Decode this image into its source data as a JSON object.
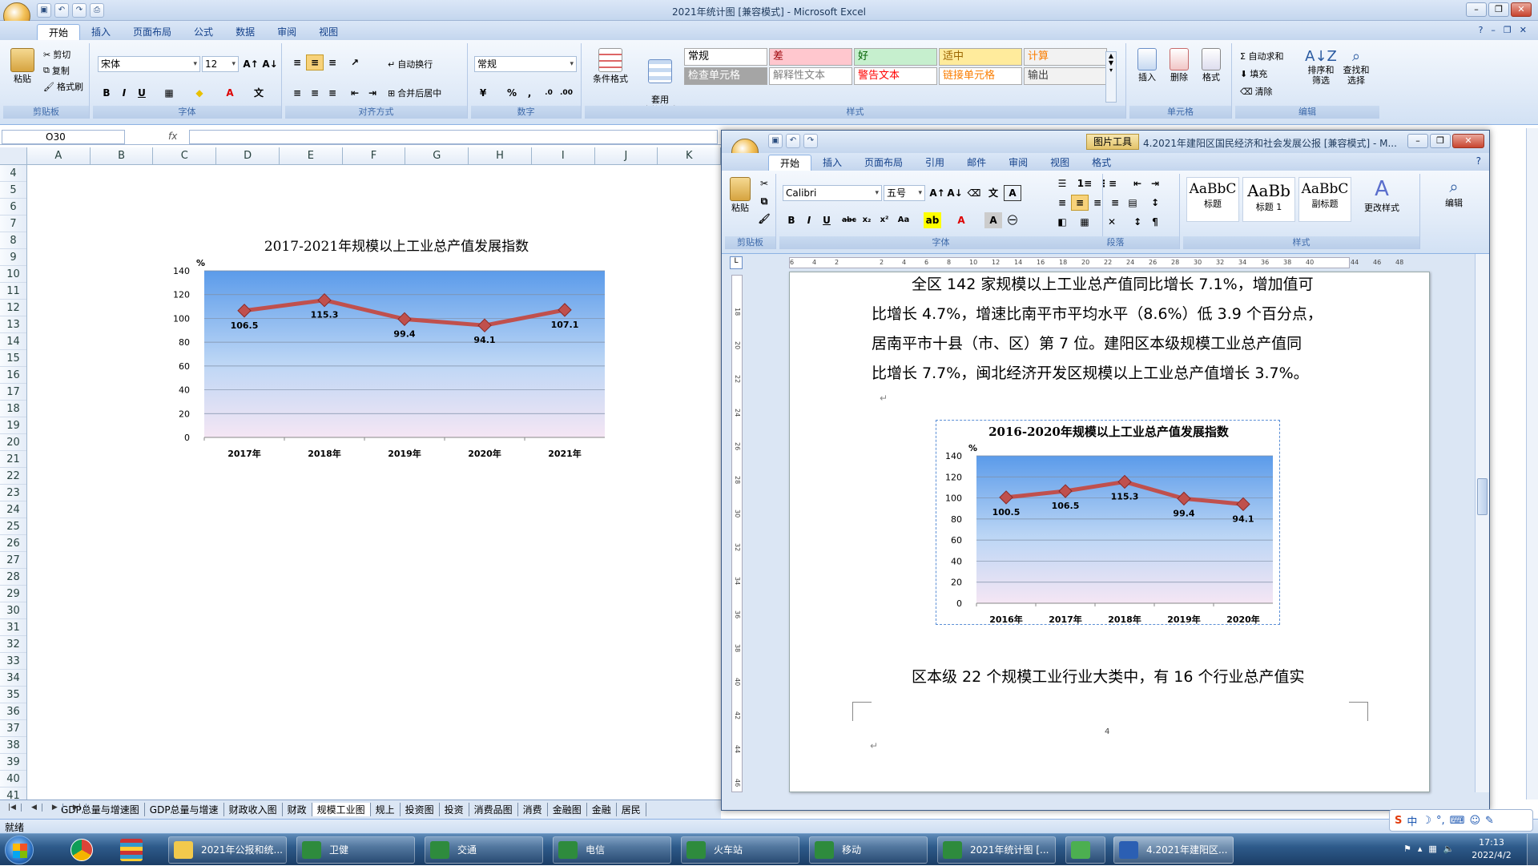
{
  "excel": {
    "title": "2021年统计图  [兼容模式] - Microsoft Excel",
    "tabs": [
      "开始",
      "插入",
      "页面布局",
      "公式",
      "数据",
      "审阅",
      "视图"
    ],
    "clipboard": {
      "paste": "粘贴",
      "cut": "剪切",
      "copy": "复制",
      "format_painter": "格式刷",
      "label": "剪贴板"
    },
    "font": {
      "name": "宋体",
      "size": "12",
      "label": "字体"
    },
    "alignment": {
      "wrap": "自动换行",
      "merge": "合并后居中",
      "label": "对齐方式"
    },
    "number": {
      "format": "常规",
      "label": "数字",
      "percent": "%",
      "comma": ","
    },
    "styles": {
      "conditional": "条件格式",
      "table_format": "套用\n表格格式",
      "cells": [
        {
          "text": "常规",
          "bg": "#ffffff",
          "color": "#000000"
        },
        {
          "text": "差",
          "bg": "#ffc7ce",
          "color": "#9c0006"
        },
        {
          "text": "好",
          "bg": "#c6efce",
          "color": "#006100"
        },
        {
          "text": "适中",
          "bg": "#ffeb9c",
          "color": "#9c6500"
        },
        {
          "text": "计算",
          "bg": "#f2f2f2",
          "color": "#fa7d00"
        },
        {
          "text": "检查单元格",
          "bg": "#a5a5a5",
          "color": "#ffffff"
        },
        {
          "text": "解释性文本",
          "bg": "#ffffff",
          "color": "#7f7f7f"
        },
        {
          "text": "警告文本",
          "bg": "#ffffff",
          "color": "#ff0000"
        },
        {
          "text": "链接单元格",
          "bg": "#ffffff",
          "color": "#fa7d00"
        },
        {
          "text": "输出",
          "bg": "#f2f2f2",
          "color": "#3f3f3f"
        }
      ],
      "label": "样式"
    },
    "cells_group": {
      "insert": "插入",
      "delete": "删除",
      "format": "格式",
      "label": "单元格"
    },
    "editing": {
      "autosum": "Σ 自动求和",
      "fill": "填充",
      "clear": "清除",
      "sort": "排序和\n筛选",
      "find": "查找和\n选择",
      "label": "编辑"
    },
    "name_box": "O30",
    "fx": "fx",
    "columns": [
      "A",
      "B",
      "C",
      "D",
      "E",
      "F",
      "G",
      "H",
      "I",
      "J",
      "K"
    ],
    "rows": [
      "4",
      "5",
      "6",
      "7",
      "8",
      "9",
      "10",
      "11",
      "12",
      "13",
      "14",
      "15",
      "16",
      "17",
      "18",
      "19",
      "20",
      "21",
      "22",
      "23",
      "24",
      "25",
      "26",
      "27",
      "28",
      "29",
      "30",
      "31",
      "32",
      "33",
      "34",
      "35",
      "36",
      "37",
      "38",
      "39",
      "40",
      "41"
    ],
    "sheet_tabs": [
      "GDP总量与增速图",
      "GDP总量与增速",
      "财政收入图",
      "财政",
      "规模工业图",
      "规上",
      "投资图",
      "投资",
      "消费品图",
      "消费",
      "金融图",
      "金融",
      "居民"
    ],
    "active_sheet": "规模工业图",
    "status": "就绪"
  },
  "word": {
    "title_tool": "图片工具",
    "title": "4.2021年建阳区国民经济和社会发展公报 [兼容模式] - M...",
    "tabs": [
      "开始",
      "插入",
      "页面布局",
      "引用",
      "邮件",
      "审阅",
      "视图",
      "格式"
    ],
    "clipboard": {
      "paste": "粘贴",
      "label": "剪贴板"
    },
    "font": {
      "name": "Calibri",
      "size": "五号",
      "label": "字体"
    },
    "paragraph": {
      "label": "段落"
    },
    "styles": {
      "items": [
        {
          "preview": "AaBbC",
          "name": "标题"
        },
        {
          "preview": "AaBb",
          "name": "标题 1"
        },
        {
          "preview": "AaBbC",
          "name": "副标题"
        }
      ],
      "change": "更改样式",
      "label": "样式"
    },
    "edit": "编辑",
    "ruler": [
      "6",
      "4",
      "2",
      "",
      "2",
      "4",
      "6",
      "8",
      "10",
      "12",
      "14",
      "16",
      "18",
      "20",
      "22",
      "24",
      "26",
      "28",
      "30",
      "32",
      "34",
      "36",
      "38",
      "40",
      "",
      "44",
      "46",
      "48"
    ],
    "vruler": [
      "18",
      "",
      "20",
      "",
      "22",
      "",
      "24",
      "",
      "26",
      "",
      "28",
      "",
      "30",
      "",
      "32",
      "",
      "34",
      "",
      "36",
      "",
      "38",
      "",
      "40",
      "",
      "42",
      "",
      "44",
      "",
      "46"
    ],
    "lines": [
      "全区 142 家规模以上工业总产值同比增长 7.1%，增加值可",
      "比增长 4.7%，增速比南平市平均水平（8.6%）低 3.9 个百分点，",
      "居南平市十县（市、区）第 7 位。建阳区本级规模工业总产值同",
      "比增长 7.7%，闽北经济开发区规模以上工业总产值增长 3.7%。"
    ],
    "after_text": "区本级 22 个规模工业行业大类中，有 16 个行业总产值实",
    "page_num": "4",
    "para_mark": "↵"
  },
  "taskbar": {
    "items": [
      "2021年公报和统...",
      "卫健",
      "交通",
      "电信",
      "火车站",
      "移动",
      "2021年统计图 [...",
      "",
      "4.2021年建阳区..."
    ],
    "ime": "中",
    "time": "17:13",
    "date": "2022/4/2"
  },
  "chart_data": [
    {
      "type": "line",
      "title": "2017-2021年规模以上工业总产值发展指数",
      "ylabel": "%",
      "categories": [
        "2017年",
        "2018年",
        "2019年",
        "2020年",
        "2021年"
      ],
      "series": [
        {
          "values": [
            106.5,
            115.3,
            99.4,
            94.1,
            107.1
          ]
        }
      ],
      "ylim": [
        0,
        140
      ],
      "yticks": [
        "0",
        "20",
        "40",
        "60",
        "80",
        "100",
        "120",
        "140"
      ],
      "grid": true,
      "legend": "none",
      "colors": {
        "line": "#c0504d",
        "marker": "#c0504d"
      }
    },
    {
      "type": "line",
      "title": "2016-2020年规模以上工业总产值发展指数",
      "ylabel": "%",
      "categories": [
        "2016年",
        "2017年",
        "2018年",
        "2019年",
        "2020年"
      ],
      "series": [
        {
          "values": [
            100.5,
            106.5,
            115.3,
            99.4,
            94.1
          ]
        }
      ],
      "ylim": [
        0,
        140
      ],
      "yticks": [
        "0",
        "20",
        "40",
        "60",
        "80",
        "100",
        "120",
        "140"
      ],
      "grid": true,
      "legend": "none",
      "colors": {
        "line": "#c0504d",
        "marker": "#c0504d"
      }
    }
  ]
}
